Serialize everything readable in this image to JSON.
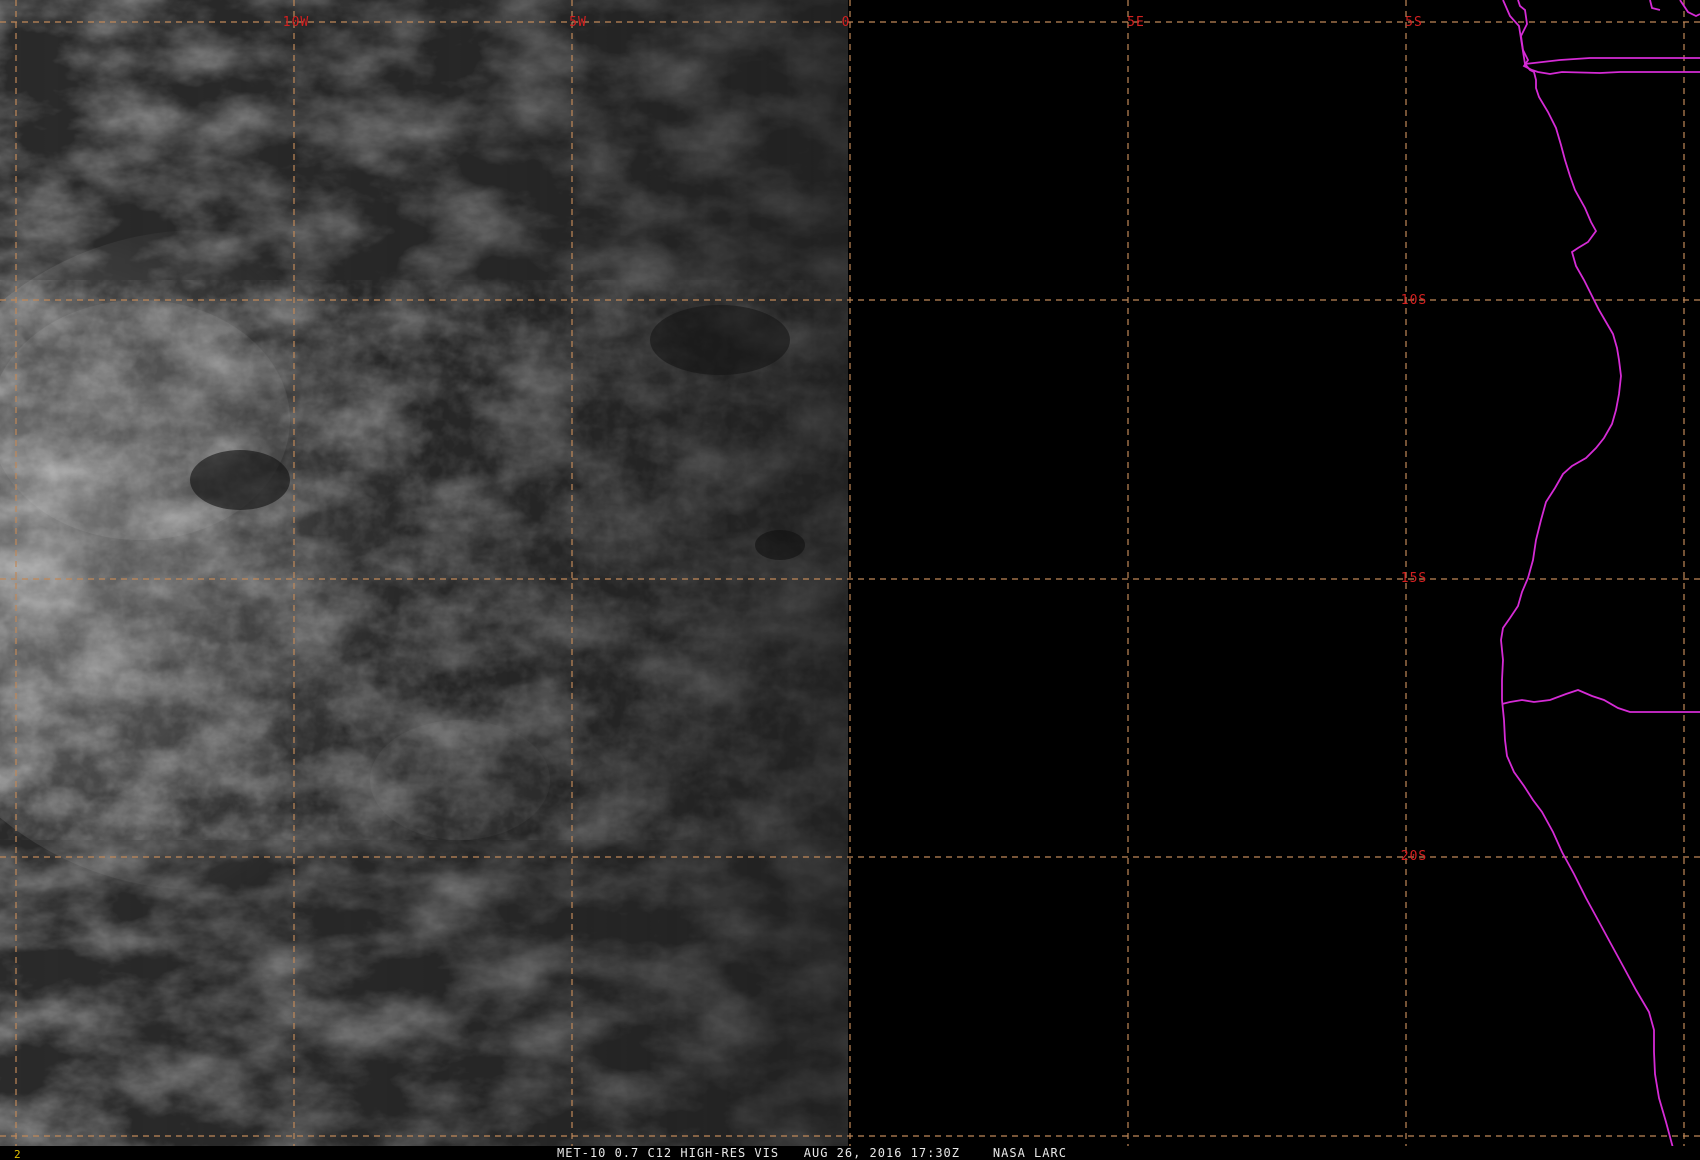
{
  "map": {
    "background_color": "#000000",
    "cloud_color": "#ffffff",
    "grid_color": "#c08858",
    "label_color": "#d42020",
    "boundary_color": "#d52bd5",
    "grid_longitude_labels": [
      "10W",
      "5W",
      "0",
      "5E"
    ],
    "grid_latitude_labels": [
      "5S",
      "10S",
      "15S",
      "20S"
    ],
    "footer": {
      "frame_number": "2",
      "caption": "MET-10 0.7 C12 HIGH-RES VIS   AUG 26, 2016 17:30Z    NASA LARC"
    }
  }
}
